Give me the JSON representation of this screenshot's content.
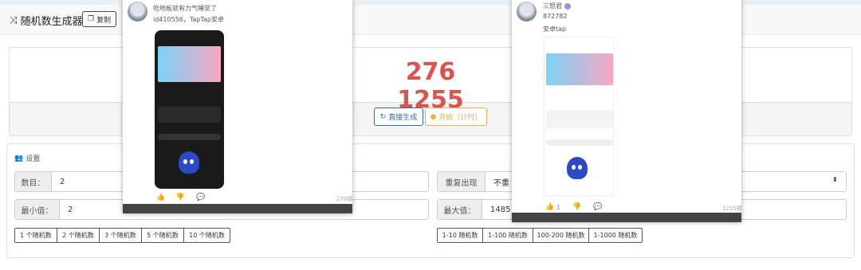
{
  "app": {
    "title": "随机数生成器",
    "copy_label": "复制"
  },
  "result": {
    "value": "276 1255",
    "direct_label": "直接生成",
    "start_label": "开始（计时）"
  },
  "settings": {
    "title": "设置",
    "count_label": "数目：",
    "count_value": "2",
    "min_label": "最小值：",
    "min_value": "2",
    "repeat_label": "重复出现",
    "repeat_value": "不重",
    "max_label": "最大值：",
    "max_value": "1485",
    "count_presets": [
      "1 个随机数",
      "2 个随机数",
      "3 个随机数",
      "5 个随机数",
      "10 个随机数"
    ],
    "range_presets": [
      "1-10 随机数",
      "1-100 随机数",
      "100-200 随机数",
      "1-1000 随机数"
    ]
  },
  "popup_left": {
    "caption": "吃地板就有力气睡觉了",
    "author": "id410556，TapTap安卓",
    "floor": "276楼"
  },
  "popup_right": {
    "name": "三怒君",
    "number": "872782",
    "platform": "安卓tap",
    "like_count": "1",
    "floor": "1255楼"
  },
  "colors": {
    "result": "#d9534f",
    "primary": "#2e6da4",
    "warning": "#f0ad4e"
  }
}
